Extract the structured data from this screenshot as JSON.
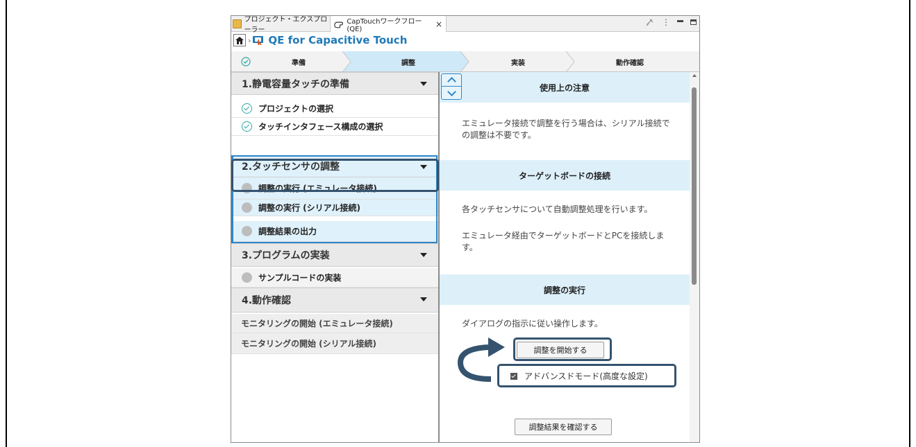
{
  "tabs": {
    "project_explorer": "プロジェクト・エクスプローラー",
    "workflow": "CapTouchワークフロー (QE)",
    "close": "×"
  },
  "header": {
    "separator": "›",
    "title": "QE for Capacitive Touch"
  },
  "steps": [
    {
      "label": "準備",
      "state": "done"
    },
    {
      "label": "調整",
      "state": "active"
    },
    {
      "label": "実装",
      "state": "pending"
    },
    {
      "label": "動作確認",
      "state": "pending"
    }
  ],
  "sidebar": {
    "sections": [
      {
        "label": "1.静電容量タッチの準備",
        "items": [
          {
            "label": "プロジェクトの選択",
            "status": "done"
          },
          {
            "label": "タッチインタフェース構成の選択",
            "status": "done"
          }
        ]
      },
      {
        "label": "2.タッチセンサの調整",
        "items": [
          {
            "label": "調整の実行 (エミュレータ接続)",
            "status": "todo"
          },
          {
            "label": "調整の実行 (シリアル接続)",
            "status": "todo"
          },
          {
            "label": "調整結果の出力",
            "status": "todo"
          }
        ]
      },
      {
        "label": "3.プログラムの実装",
        "items": [
          {
            "label": "サンプルコードの実装",
            "status": "todo"
          }
        ]
      },
      {
        "label": "4.動作確認",
        "items": [
          {
            "label": "モニタリングの開始 (エミュレータ接続)"
          },
          {
            "label": "モニタリングの開始 (シリアル接続)"
          }
        ]
      }
    ]
  },
  "content": {
    "sections": [
      {
        "title": "使用上の注意",
        "body": "エミュレータ接続で調整を行う場合は、シリアル接続での調整は不要です。"
      },
      {
        "title": "ターゲットボードの接続",
        "body": "各タッチセンサについて自動調整処理を行います。",
        "body2": "エミュレータ経由でターゲットボードとPCを接続します。"
      },
      {
        "title": "調整の実行",
        "body": "ダイアログの指示に従い操作します。"
      }
    ],
    "start_button": "調整を開始する",
    "advanced_mode": {
      "label": "アドバンスドモード(高度な設定)",
      "checked": true
    },
    "check_results_button": "調整結果を確認する"
  },
  "colors": {
    "accent": "#2e86c9",
    "active_bg": "#dff1fb",
    "highlight_frame": "#34536f",
    "title_blue": "#1f7ab8"
  }
}
